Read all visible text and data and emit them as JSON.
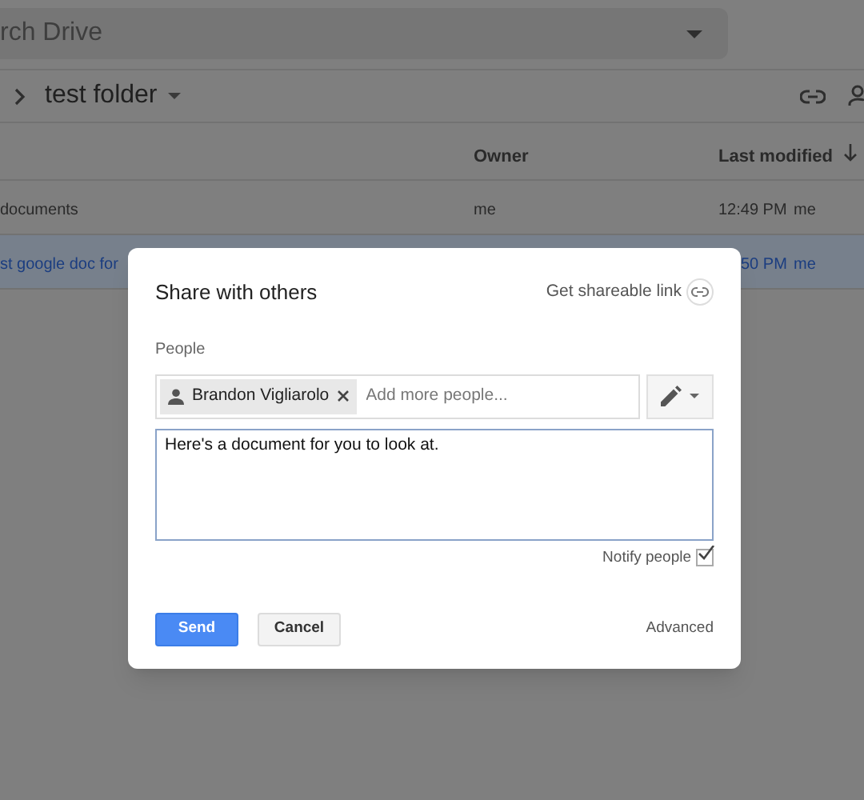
{
  "search": {
    "placeholder": "rch Drive"
  },
  "breadcrumb": {
    "folder": "test folder"
  },
  "table": {
    "columns": [
      {
        "label": "Owner"
      },
      {
        "label": "Last modified"
      }
    ],
    "rows": [
      {
        "name": "documents",
        "owner": "me",
        "modified": "12:49 PM",
        "modified_by": "me",
        "selected": false
      },
      {
        "name": "st google doc for",
        "owner": "",
        "modified": "50 PM",
        "modified_by": "me",
        "selected": true
      }
    ]
  },
  "dialog": {
    "title": "Share with others",
    "link_label": "Get shareable link",
    "people_label": "People",
    "chips": [
      {
        "name": "Brandon Vigliarolo"
      }
    ],
    "people_placeholder": "Add more people...",
    "message": "Here's a document for you to look at.",
    "notify": {
      "label": "Notify people",
      "checked": true
    },
    "buttons": [
      {
        "label": "Send",
        "kind": "primary"
      },
      {
        "label": "Cancel",
        "kind": "secondary"
      }
    ],
    "advanced": "Advanced"
  }
}
